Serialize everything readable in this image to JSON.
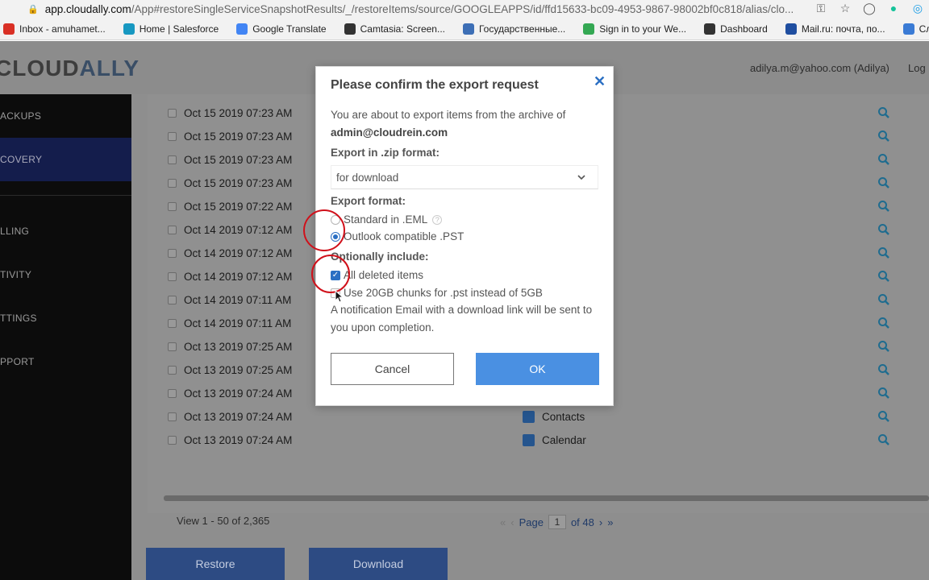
{
  "browser": {
    "url_host": "app.cloudally.com",
    "url_path": "/App#restoreSingleServiceSnapshotResults/_/restoreItems/source/GOOGLEAPPS/id/ffd15633-bc09-4953-9867-98002bf0c818/alias/clo...",
    "bookmarks": [
      {
        "label": "Inbox - amuhamet...",
        "icon": "gmail-icon",
        "color": "#d93025"
      },
      {
        "label": "Home | Salesforce",
        "icon": "salesforce-icon",
        "color": "#1798c1"
      },
      {
        "label": "Google Translate",
        "icon": "translate-icon",
        "color": "#4285f4"
      },
      {
        "label": "Camtasia: Screen...",
        "icon": "camtasia-icon",
        "color": "#333333"
      },
      {
        "label": "Государственные...",
        "icon": "gov-icon",
        "color": "#3d6fb6"
      },
      {
        "label": "Sign in to your We...",
        "icon": "globe-icon",
        "color": "#34a853"
      },
      {
        "label": "Dashboard",
        "icon": "dashboard-icon",
        "color": "#333333"
      },
      {
        "label": "Mail.ru: почта, по...",
        "icon": "mailru-icon",
        "color": "#1f4ea0"
      },
      {
        "label": "Словарь Мультит",
        "icon": "dictionary-icon",
        "color": "#3a7bd5"
      }
    ]
  },
  "header": {
    "logo_left": "CLOUD",
    "logo_right": "ALLY",
    "user": "adilya.m@yahoo.com (Adilya)",
    "logout": "Log"
  },
  "sidebar": {
    "items": [
      {
        "label": "ACKUPS",
        "active": false
      },
      {
        "label": "COVERY",
        "active": true
      },
      {
        "label": "LLING",
        "active": false
      },
      {
        "label": "TIVITY",
        "active": false
      },
      {
        "label": "TTINGS",
        "active": false
      },
      {
        "label": "PPORT",
        "active": false
      }
    ]
  },
  "rows": [
    {
      "date": "Oct 15 2019 07:23 AM",
      "service": ""
    },
    {
      "date": "Oct 15 2019 07:23 AM",
      "service": ""
    },
    {
      "date": "Oct 15 2019 07:23 AM",
      "service": ""
    },
    {
      "date": "Oct 15 2019 07:23 AM",
      "service": ""
    },
    {
      "date": "Oct 15 2019 07:22 AM",
      "service": ""
    },
    {
      "date": "Oct 14 2019 07:12 AM",
      "service": ""
    },
    {
      "date": "Oct 14 2019 07:12 AM",
      "service": ""
    },
    {
      "date": "Oct 14 2019 07:12 AM",
      "service": ""
    },
    {
      "date": "Oct 14 2019 07:11 AM",
      "service": ""
    },
    {
      "date": "Oct 14 2019 07:11 AM",
      "service": ""
    },
    {
      "date": "Oct 13 2019 07:25 AM",
      "service": ""
    },
    {
      "date": "Oct 13 2019 07:25 AM",
      "service": ""
    },
    {
      "date": "Oct 13 2019 07:24 AM",
      "service": ""
    },
    {
      "date": "Oct 13 2019 07:24 AM",
      "service": "Contacts"
    },
    {
      "date": "Oct 13 2019 07:24 AM",
      "service": "Calendar"
    }
  ],
  "pager": {
    "count": "View 1 - 50 of 2,365",
    "page_label": "Page",
    "page_value": "1",
    "of_label": "of 48"
  },
  "actions": {
    "restore": "Restore",
    "download": "Download"
  },
  "modal": {
    "title": "Please confirm the export request",
    "intro": "You are about to export items from the archive of",
    "account": "admin@cloudrein.com",
    "zip_label": "Export in .zip format:",
    "zip_value": "for download",
    "format_label": "Export format:",
    "format_eml": "Standard in .EML",
    "format_pst": "Outlook compatible .PST",
    "format_selected": "pst",
    "optional_label": "Optionally include:",
    "opt_deleted": "All deleted items",
    "opt_deleted_checked": true,
    "opt_chunks": "Use 20GB chunks for .pst instead of 5GB",
    "opt_chunks_checked": false,
    "note": "A notification Email with a download link will be sent to you upon completion.",
    "cancel": "Cancel",
    "ok": "OK"
  },
  "colors": {
    "accent": "#4a90e2",
    "link": "#2b6fc3",
    "annotation": "#d0101a"
  }
}
